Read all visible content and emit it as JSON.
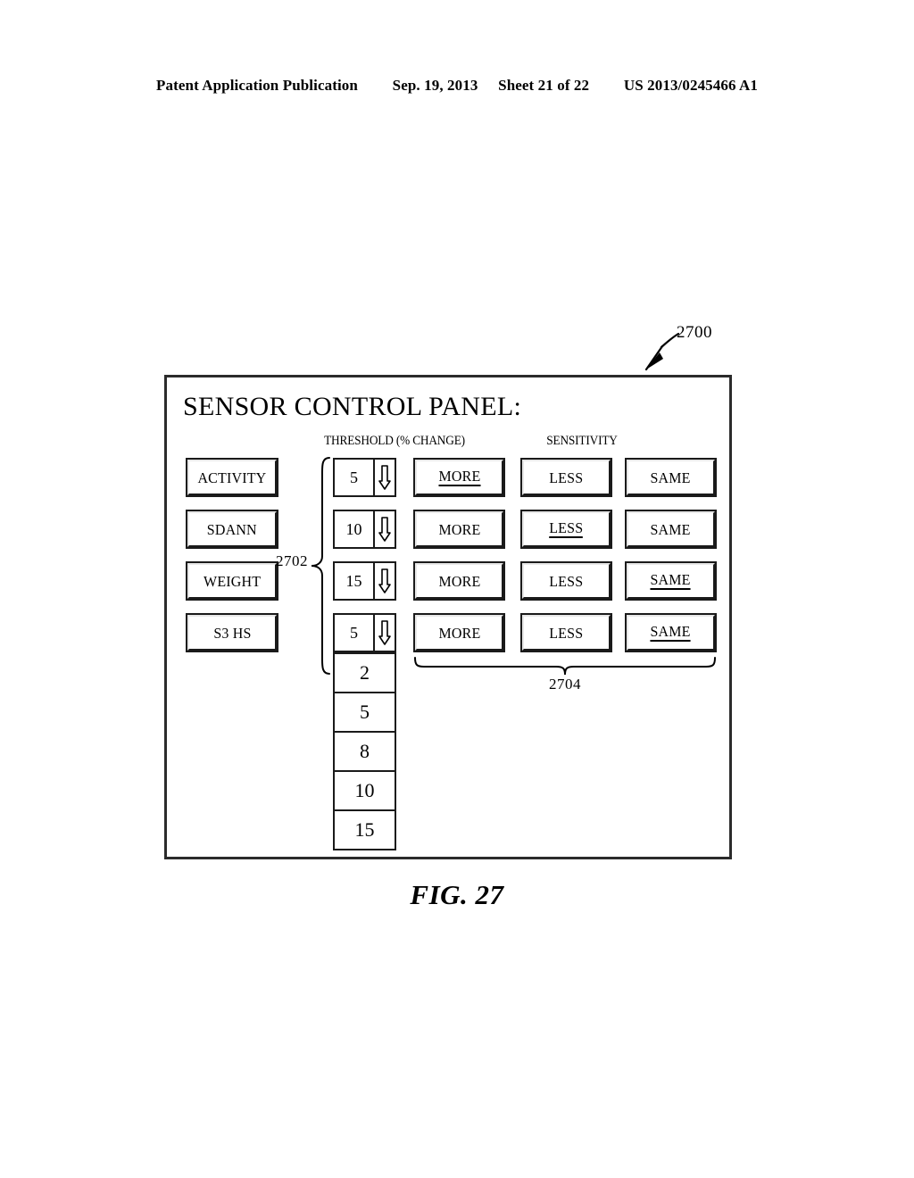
{
  "page_header": {
    "publication": "Patent Application Publication",
    "date": "Sep. 19, 2013",
    "sheet": "Sheet 21 of 22",
    "patent_number": "US 2013/0245466 A1"
  },
  "figure": {
    "caption": "FIG. 27",
    "panel_reference": "2700",
    "threshold_group_reference": "2702",
    "sensitivity_group_reference": "2704"
  },
  "panel": {
    "title": "SENSOR CONTROL PANEL:",
    "headers": {
      "threshold": "THRESHOLD (% CHANGE)",
      "sensitivity": "SENSITIVITY"
    },
    "rows": [
      {
        "sensor": "ACTIVITY",
        "threshold_value": "5",
        "sensitivity": {
          "more": "MORE",
          "less": "LESS",
          "same": "SAME"
        },
        "selected": "more"
      },
      {
        "sensor": "SDANN",
        "threshold_value": "10",
        "sensitivity": {
          "more": "MORE",
          "less": "LESS",
          "same": "SAME"
        },
        "selected": "less"
      },
      {
        "sensor": "WEIGHT",
        "threshold_value": "15",
        "sensitivity": {
          "more": "MORE",
          "less": "LESS",
          "same": "SAME"
        },
        "selected": "same"
      },
      {
        "sensor": "S3 HS",
        "threshold_value": "5",
        "sensitivity": {
          "more": "MORE",
          "less": "LESS",
          "same": "SAME"
        },
        "selected": "same"
      }
    ],
    "threshold_dropdown_options": [
      "2",
      "5",
      "8",
      "10",
      "15"
    ]
  },
  "colors": {
    "ink": "#000000",
    "border": "#1a1a1a",
    "panel_border": "#2b2b2b",
    "background": "#ffffff"
  }
}
